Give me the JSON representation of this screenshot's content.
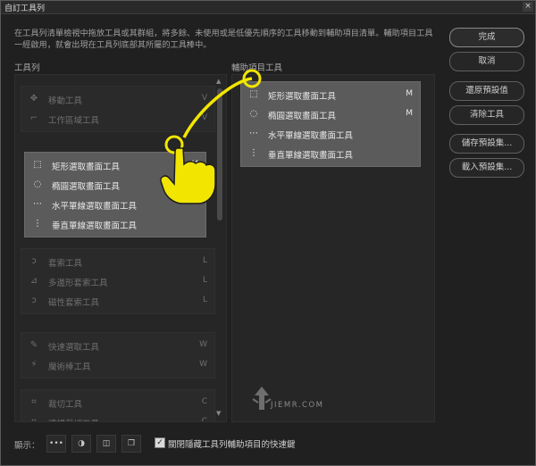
{
  "window": {
    "title": "自訂工具列",
    "close_glyph": "×"
  },
  "description": "在工具列清單檢視中拖放工具或其群組，將多餘、未使用或是低優先順序的工具移動到輔助項目清單。輔助項目工具一經啟用，就會出現在工具列底部其所屬的工具棒中。",
  "sections": {
    "toolbar": "工具列",
    "extra": "輔助項目工具"
  },
  "left_groups": [
    {
      "selected": false,
      "items": [
        {
          "icon": "move-icon",
          "glyph": "✥",
          "label": "移動工具",
          "key": "V"
        },
        {
          "icon": "artboard-icon",
          "glyph": "⌐",
          "label": "工作區域工具",
          "key": "V"
        }
      ]
    },
    {
      "selected": true,
      "items": [
        {
          "icon": "rect-marquee-icon",
          "glyph": "⬚",
          "label": "矩形選取畫面工具",
          "key": "M"
        },
        {
          "icon": "ellipse-marquee-icon",
          "glyph": "◌",
          "label": "橢圓選取畫面工具",
          "key": ""
        },
        {
          "icon": "single-row-marquee-icon",
          "glyph": "⋯",
          "label": "水平單線選取畫面工具",
          "key": ""
        },
        {
          "icon": "single-column-marquee-icon",
          "glyph": "⋮",
          "label": "垂直單線選取畫面工具",
          "key": ""
        }
      ]
    },
    {
      "selected": false,
      "items": [
        {
          "icon": "lasso-icon",
          "glyph": "ↄ",
          "label": "套索工具",
          "key": "L"
        },
        {
          "icon": "polygonal-lasso-icon",
          "glyph": "⊿",
          "label": "多邊形套索工具",
          "key": "L"
        },
        {
          "icon": "magnetic-lasso-icon",
          "glyph": "ↄ",
          "label": "磁性套索工具",
          "key": "L"
        }
      ]
    },
    {
      "selected": false,
      "items": [
        {
          "icon": "quick-select-icon",
          "glyph": "✎",
          "label": "快速選取工具",
          "key": "W"
        },
        {
          "icon": "magic-wand-icon",
          "glyph": "⚡",
          "label": "魔術棒工具",
          "key": "W"
        }
      ]
    },
    {
      "selected": false,
      "items": [
        {
          "icon": "crop-icon",
          "glyph": "⌗",
          "label": "裁切工具",
          "key": "C"
        },
        {
          "icon": "perspective-crop-icon",
          "glyph": "⌗",
          "label": "透視裁切工具",
          "key": "C"
        }
      ]
    }
  ],
  "right_group": {
    "items": [
      {
        "icon": "rect-marquee-icon",
        "glyph": "⬚",
        "label": "矩形選取畫面工具",
        "key": "M"
      },
      {
        "icon": "ellipse-marquee-icon",
        "glyph": "◌",
        "label": "橢圓選取畫面工具",
        "key": "M"
      },
      {
        "icon": "single-row-marquee-icon",
        "glyph": "⋯",
        "label": "水平單線選取畫面工具",
        "key": ""
      },
      {
        "icon": "single-column-marquee-icon",
        "glyph": "⋮",
        "label": "垂直單線選取畫面工具",
        "key": ""
      }
    ]
  },
  "buttons": {
    "done": "完成",
    "cancel": "取消",
    "restore": "還原預設值",
    "clear": "清除工具",
    "save_preset": "儲存預設集...",
    "load_preset": "載入預設集..."
  },
  "footer": {
    "show_label": "顯示：",
    "icons": [
      {
        "icon": "more-icon",
        "glyph": "•••"
      },
      {
        "icon": "screen-mode-icon",
        "glyph": "◑"
      },
      {
        "icon": "quick-mask-icon",
        "glyph": "◫"
      },
      {
        "icon": "window-mode-icon",
        "glyph": "❐"
      }
    ],
    "checkbox_checked": true,
    "checkbox_glyph": "✓",
    "checkbox_label": "關閉隱藏工具列輔助項目的快速鍵"
  },
  "watermark": "JIEMR.COM",
  "annotation": {
    "color": "#f2e600"
  }
}
